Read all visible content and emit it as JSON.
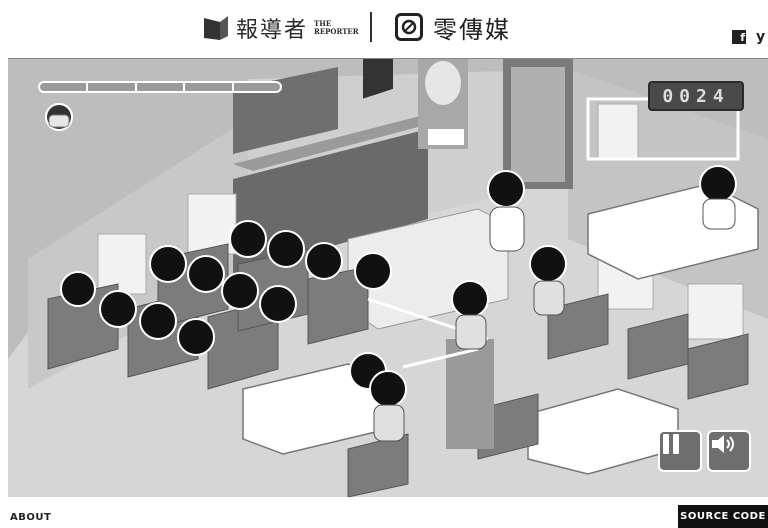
{
  "header": {
    "logo_left_zh": "報導者",
    "logo_left_en_line1": "THE",
    "logo_left_en_line2": "REPORTER",
    "logo_right_zh": "零傳媒",
    "social": [
      "facebook-icon",
      "twitter-icon"
    ]
  },
  "game": {
    "score": "0024",
    "progress_segments": 5,
    "lives_count": 5,
    "controls": [
      "pause-icon",
      "sound-icon"
    ]
  },
  "footer": {
    "about_label": "ABOUT",
    "source_label": "SOURCE CODE"
  }
}
